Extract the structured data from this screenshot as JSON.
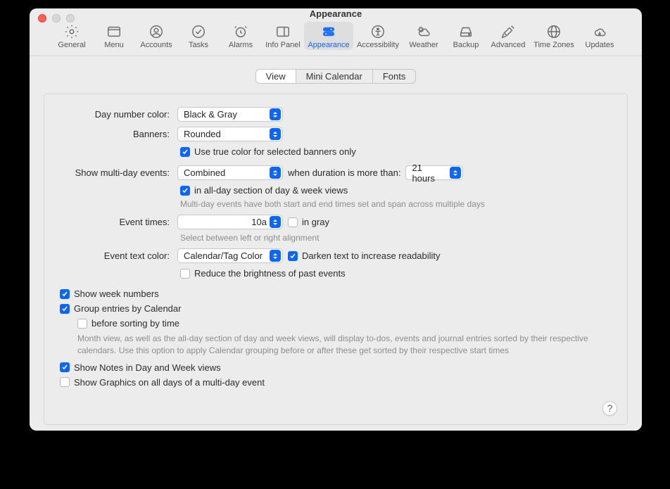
{
  "window": {
    "title": "Appearance"
  },
  "toolbar": {
    "general": "General",
    "menu": "Menu",
    "accounts": "Accounts",
    "tasks": "Tasks",
    "alarms": "Alarms",
    "infopanel": "Info Panel",
    "appearance": "Appearance",
    "accessibility": "Accessibility",
    "weather": "Weather",
    "backup": "Backup",
    "advanced": "Advanced",
    "timezones": "Time Zones",
    "updates": "Updates"
  },
  "segtabs": {
    "view": "View",
    "mini": "Mini Calendar",
    "fonts": "Fonts"
  },
  "labels": {
    "daynumber": "Day number color:",
    "banners": "Banners:",
    "multiday": "Show multi-day events:",
    "whenduration": "when duration is more than:",
    "eventtimes": "Event times:",
    "eventtextcolor": "Event text color:"
  },
  "values": {
    "daynumber": "Black & Gray",
    "banners": "Rounded",
    "multiday": "Combined",
    "duration": "21 hours",
    "eventtimes": "10a",
    "eventtextcolor": "Calendar/Tag Color"
  },
  "checks": {
    "truecolor": "Use true color for selected banners only",
    "inallday": "in all-day section of day & week views",
    "ingray": "in gray",
    "darken": "Darken text to increase readability",
    "reduce": "Reduce the brightness of past events",
    "weeknumbers": "Show week numbers",
    "groupentries": "Group entries by Calendar",
    "beforesort": "before sorting by time",
    "shownotes": "Show Notes in Day and Week views",
    "showgraphics": "Show Graphics on all days of a multi-day event"
  },
  "hints": {
    "multiday": "Multi-day events have both start and end times set and span across multiple days",
    "eventtimes": "Select between left or right alignment",
    "groupdesc": "Month view, as well as the all-day section of day and week views, will display to-dos, events and journal entries sorted by their respective calendars. Use this option to apply Calendar grouping before or after these get sorted by their respective start times"
  },
  "help": "?"
}
